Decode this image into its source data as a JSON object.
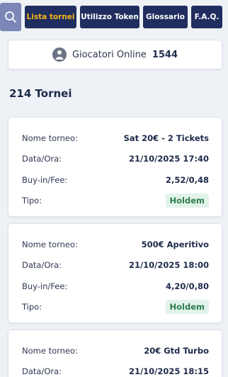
{
  "nav": {
    "tabs": [
      {
        "label": "Lista tornei",
        "active": true
      },
      {
        "label": "Utilizzo Token",
        "active": false
      },
      {
        "label": "Glossario",
        "active": false
      },
      {
        "label": "F.A.Q.",
        "active": false
      }
    ]
  },
  "online": {
    "label": "Giocatori Online",
    "count": "1544"
  },
  "tournaments": {
    "count_label": "214 Tornei",
    "labels": {
      "name": "Nome torneo:",
      "date": "Data/Ora:",
      "buyin": "Buy-in/Fee:",
      "type": "Tipo:"
    },
    "items": [
      {
        "name": "Sat 20€ - 2 Tickets",
        "date": "21/10/2025 17:40",
        "buyin": "2,52/0,48",
        "type": "Holdem"
      },
      {
        "name": "500€ Aperitivo",
        "date": "21/10/2025 18:00",
        "buyin": "4,20/0,80",
        "type": "Holdem"
      },
      {
        "name": "20€ Gtd Turbo",
        "date": "21/10/2025 18:15"
      }
    ]
  },
  "colors": {
    "nav_bg": "#1f2e5e",
    "active_tab_text": "#f3b51a",
    "badge_bg": "#e2f3ea",
    "badge_text": "#2e7d4f"
  }
}
